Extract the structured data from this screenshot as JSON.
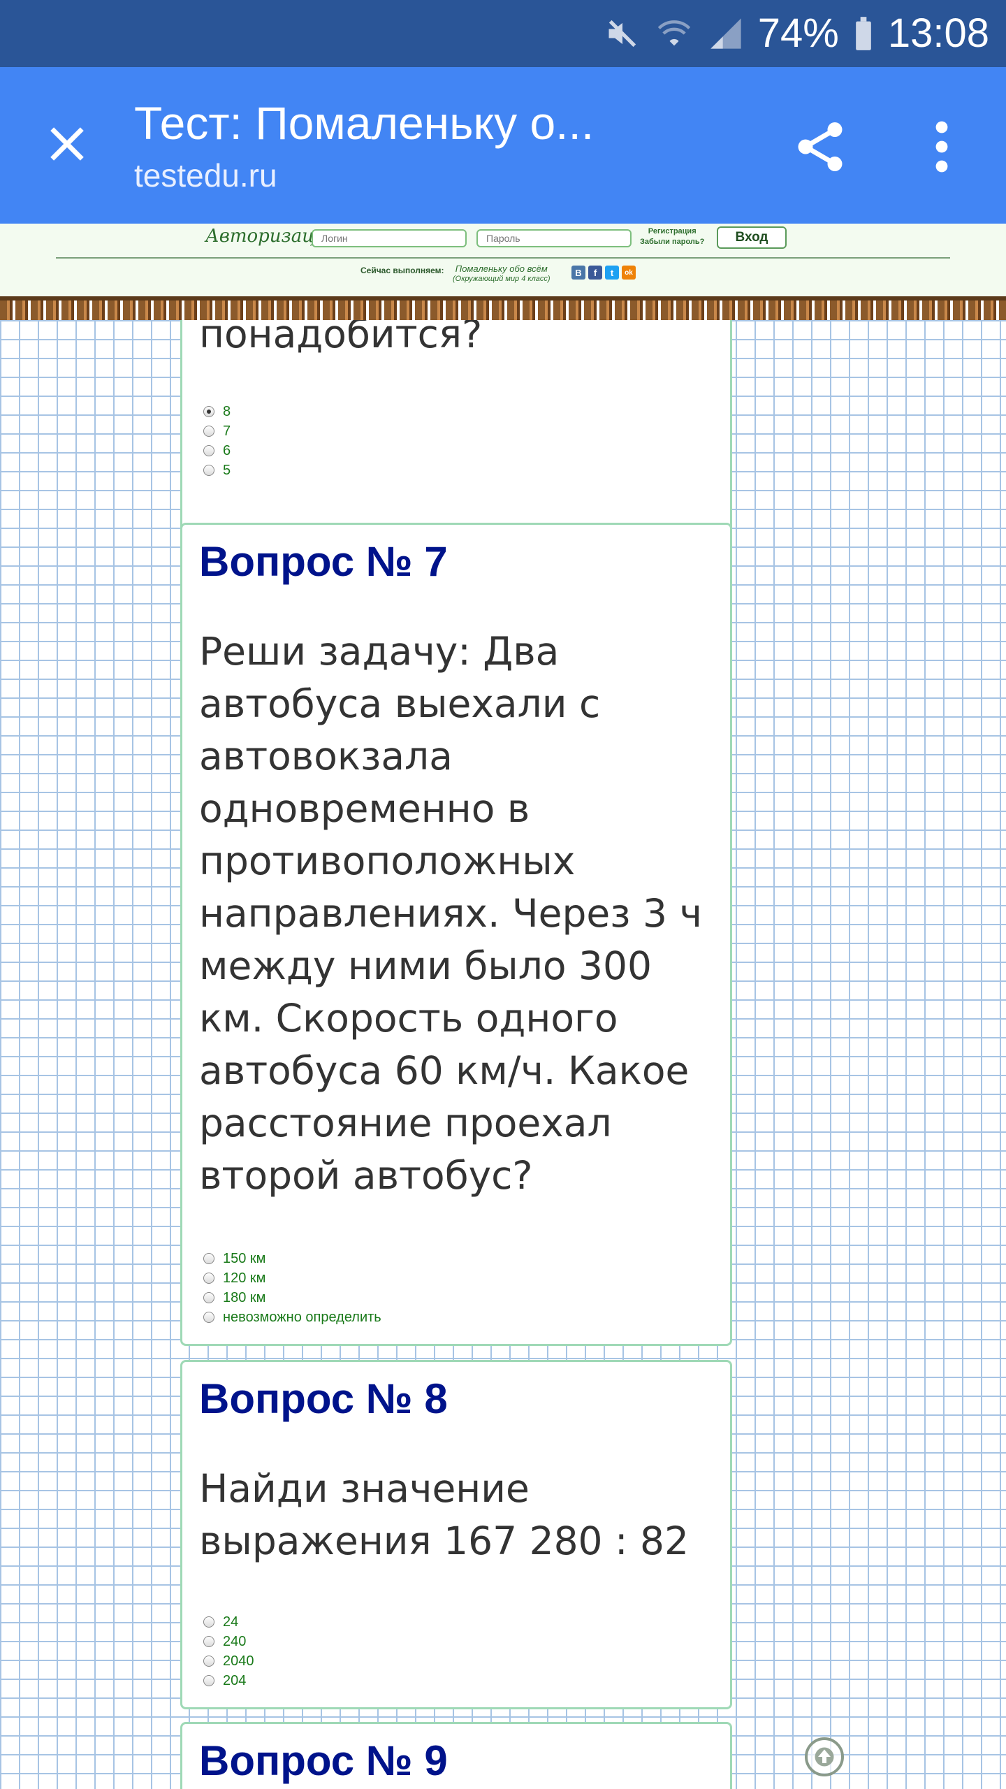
{
  "status_bar": {
    "battery": "74%",
    "time": "13:08",
    "icons": [
      "mute-icon",
      "wifi-icon",
      "signal-icon",
      "battery-icon"
    ]
  },
  "toolbar": {
    "title": "Тест: Помаленьку о...",
    "url": "testedu.ru",
    "icons": [
      "close-icon",
      "share-icon",
      "more-vert-icon"
    ]
  },
  "site_header": {
    "auth_label": "Авторизация",
    "login_placeholder": "Логин",
    "password_placeholder": "Пароль",
    "register_link": "Регистрация",
    "forgot_link": "Забыли пароль?",
    "login_button": "Вход",
    "now_label": "Сейчас выполняем:",
    "now_title": "Помаленьку обо всём",
    "now_subtitle": "(Окружающий мир 4 класс)",
    "social": [
      "В",
      "f",
      "t",
      "ok"
    ],
    "social_colors": [
      "#4a76a8",
      "#3b5998",
      "#1da1f2",
      "#ee8208"
    ]
  },
  "questions": [
    {
      "text": "понадобится?",
      "options": [
        "8",
        "7",
        "6",
        "5"
      ],
      "selected": 0
    },
    {
      "heading": "Вопрос № 7",
      "text_lines": [
        "Реши задачу: Два",
        "автобуса выехали с",
        "автовокзала",
        "одновременно в",
        "противоположных",
        "направлениях. Через 3 ч",
        "между ними было 300",
        "км. Скорость одного",
        "автобуса 60 км/ч. Какое",
        "расстояние проехал",
        "второй автобус?"
      ],
      "options": [
        "150 км",
        "120 км",
        "180 км",
        "невозможно определить"
      ]
    },
    {
      "heading": "Вопрос № 8",
      "text_lines": [
        "Найди значение",
        "выражения 167 280 : 82"
      ],
      "options": [
        "24",
        "240",
        "2040",
        "204"
      ]
    },
    {
      "heading": "Вопрос № 9"
    }
  ],
  "colors": {
    "status_bar": "#2a5597",
    "toolbar": "#4285f4",
    "heading": "#00138b",
    "option_text": "#1a7a1a",
    "card_border": "#9fd9b6",
    "grid_line": "#a7c4e4"
  }
}
